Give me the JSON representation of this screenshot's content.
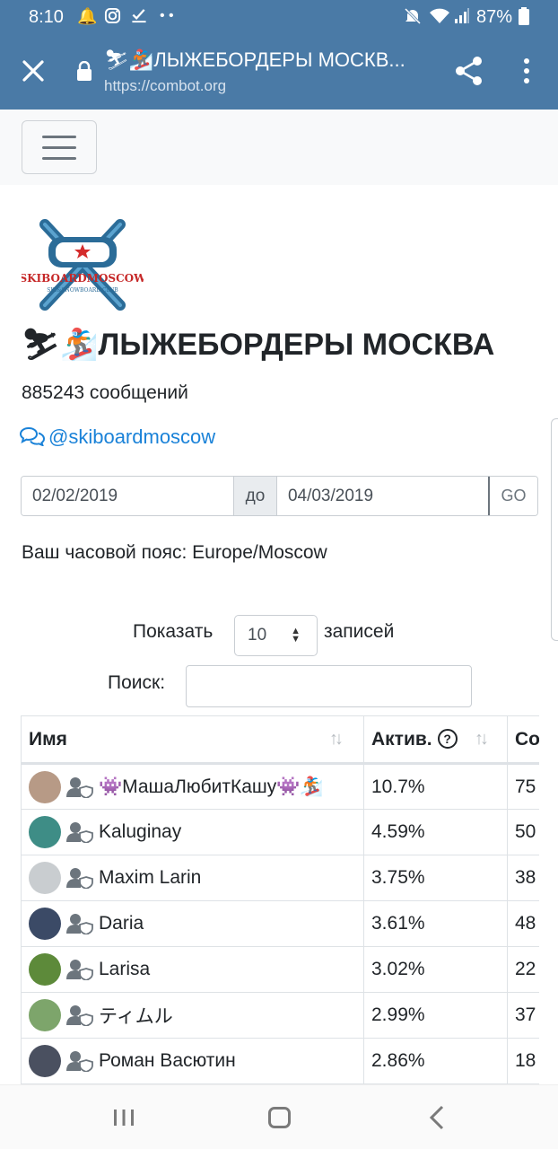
{
  "status_bar": {
    "time": "8:10",
    "battery": "87%",
    "icons_left": [
      "alarm-icon",
      "instagram-icon",
      "check-icon",
      "dots-icon"
    ],
    "icons_right": [
      "mute-icon",
      "wifi-icon",
      "signal-icon",
      "battery-icon"
    ]
  },
  "browser": {
    "title": "⛷🏂ЛЫЖЕБОРДЕРЫ МОСКВ...",
    "url": "https://combot.org"
  },
  "chat": {
    "logo_text": "SKIBOARDMOSCOW",
    "logo_subtext": "SKI&SNOWBOARD CLUB",
    "title": "⛷🏂ЛЫЖЕБОРДЕРЫ МОСКВА",
    "messages": "885243 сообщений",
    "link": "@skiboardmoscow"
  },
  "date_filter": {
    "from": "02/02/2019",
    "separator": "до",
    "to": "04/03/2019",
    "go_label": "GO"
  },
  "timezone": "Ваш часовой пояс: Europe/Moscow",
  "table_controls": {
    "show_label": "Показать",
    "page_size": "10",
    "records_label": "записей",
    "search_label": "Поиск:",
    "search_value": ""
  },
  "table": {
    "columns": [
      "Имя",
      "Актив.",
      "Со"
    ],
    "rows": [
      {
        "name": "👾МашаЛюбитКашу👾🏂",
        "activity": "10.7%",
        "count": "75",
        "avatar_color": "#b79a86"
      },
      {
        "name": "Kaluginay",
        "activity": "4.59%",
        "count": "50",
        "avatar_color": "#3e8d86"
      },
      {
        "name": "Maxim Larin",
        "activity": "3.75%",
        "count": "38",
        "avatar_color": "#c9cdd0"
      },
      {
        "name": "Daria",
        "activity": "3.61%",
        "count": "48",
        "avatar_color": "#3b4a66"
      },
      {
        "name": "Larisa",
        "activity": "3.02%",
        "count": "22",
        "avatar_color": "#5d8a3a"
      },
      {
        "name": "ティムル",
        "activity": "2.99%",
        "count": "37",
        "avatar_color": "#7da56b"
      },
      {
        "name": "Роман Васютин",
        "activity": "2.86%",
        "count": "18",
        "avatar_color": "#4a5060"
      }
    ]
  },
  "colors": {
    "chrome": "#4a7aa6",
    "link": "#1a82d8",
    "text": "#212529"
  }
}
